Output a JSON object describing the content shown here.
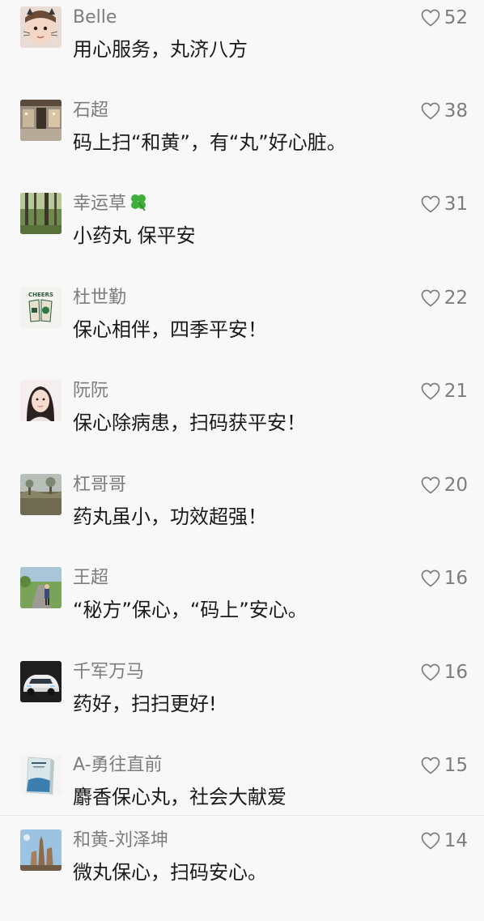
{
  "comments": [
    {
      "name": "Belle",
      "text": "用心服务，丸济八方",
      "likes": "52",
      "avatar": "baby-photo"
    },
    {
      "name": "石超",
      "text": "码上扫“和黄”，有“丸”好心脏。",
      "likes": "38",
      "avatar": "shop-photo"
    },
    {
      "name": "幸运草",
      "text": "小药丸 保平安",
      "likes": "31",
      "avatar": "forest-photo",
      "name_icon": "four-leaf-clover-emoji"
    },
    {
      "name": "杜世勤",
      "text": "保心相伴，四季平安！",
      "likes": "22",
      "avatar": "cheers-cups-logo",
      "avatar_text": "CHEERS"
    },
    {
      "name": "阮阮",
      "text": "保心除病患，扫码获平安！",
      "likes": "21",
      "avatar": "girl-photo"
    },
    {
      "name": "杠哥哥",
      "text": "药丸虽小，功效超强！",
      "likes": "20",
      "avatar": "field-photo"
    },
    {
      "name": "王超",
      "text": "“秘方”保心，“码上”安心。",
      "likes": "16",
      "avatar": "road-photo"
    },
    {
      "name": "千军万马",
      "text": "药好，扫扫更好!",
      "likes": "16",
      "avatar": "car-photo"
    },
    {
      "name": "A-勇往直前",
      "text": "麝香保心丸，社会大献爱",
      "likes": "15",
      "avatar": "book-cover"
    },
    {
      "name": "和黄-刘泽坤",
      "text": "微丸保心，扫码安心。",
      "likes": "14",
      "avatar": "tower-photo"
    }
  ],
  "icons": {
    "like": "heart-outline-icon"
  }
}
